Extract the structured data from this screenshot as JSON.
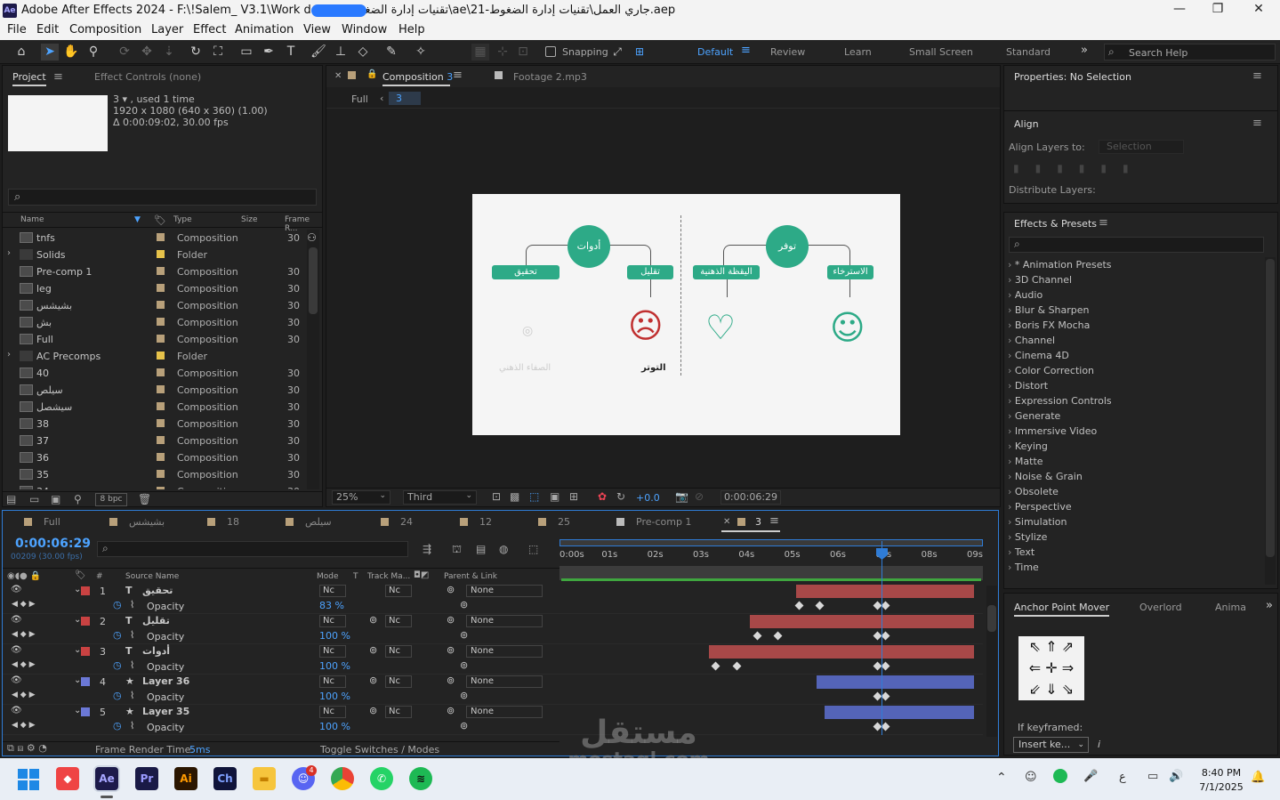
{
  "title": {
    "app_badge": "Ae",
    "text": "Adobe After Effects 2024 - F:\\!Salem_ V3.1\\Work d ... 21-تقنيات إدارة الضغوط\\ae\\جاري العمل\\تقنيات إدارة الضغوط-21.aep",
    "minimize": "—",
    "maximize": "❐",
    "close": "✕"
  },
  "menu": [
    "File",
    "Edit",
    "Composition",
    "Layer",
    "Effect",
    "Animation",
    "View",
    "Window",
    "Help"
  ],
  "toolbar": {
    "snapping": "Snapping",
    "workspaces": [
      "Default",
      "Review",
      "Learn",
      "Small Screen",
      "Standard"
    ],
    "more": "»",
    "search_help": "Search Help"
  },
  "project": {
    "tab_project": "Project",
    "tab_effects": "Effect Controls (none)",
    "info_line1": "3 ▾ , used 1 time",
    "info_line2": "1920 x 1080  (640 x 360) (1.00)",
    "info_line3": "Δ 0:00:09:02, 30.00 fps",
    "search_icon": "⌕",
    "columns": {
      "name": "Name",
      "type": "Type",
      "size": "Size",
      "frame": "Frame R..."
    },
    "items": [
      {
        "name": "tnfs",
        "type": "Composition",
        "fr": "30",
        "kind": "comp",
        "label": "#b8a07a"
      },
      {
        "name": "Solids",
        "type": "Folder",
        "fr": "",
        "kind": "folder",
        "label": "#e6c24a"
      },
      {
        "name": "Pre-comp 1",
        "type": "Composition",
        "fr": "30",
        "kind": "comp",
        "label": "#b8a07a"
      },
      {
        "name": "leg",
        "type": "Composition",
        "fr": "30",
        "kind": "comp",
        "label": "#b8a07a"
      },
      {
        "name": "بشيشس",
        "type": "Composition",
        "fr": "30",
        "kind": "comp",
        "label": "#b8a07a"
      },
      {
        "name": "بش",
        "type": "Composition",
        "fr": "30",
        "kind": "comp",
        "label": "#b8a07a"
      },
      {
        "name": "Full",
        "type": "Composition",
        "fr": "30",
        "kind": "comp",
        "label": "#b8a07a"
      },
      {
        "name": "AC Precomps",
        "type": "Folder",
        "fr": "",
        "kind": "folder",
        "label": "#e6c24a"
      },
      {
        "name": "40",
        "type": "Composition",
        "fr": "30",
        "kind": "comp",
        "label": "#b8a07a"
      },
      {
        "name": "سيلص",
        "type": "Composition",
        "fr": "30",
        "kind": "comp",
        "label": "#b8a07a"
      },
      {
        "name": "سيشصل",
        "type": "Composition",
        "fr": "30",
        "kind": "comp",
        "label": "#b8a07a"
      },
      {
        "name": "38",
        "type": "Composition",
        "fr": "30",
        "kind": "comp",
        "label": "#b8a07a"
      },
      {
        "name": "37",
        "type": "Composition",
        "fr": "30",
        "kind": "comp",
        "label": "#b8a07a"
      },
      {
        "name": "36",
        "type": "Composition",
        "fr": "30",
        "kind": "comp",
        "label": "#b8a07a"
      },
      {
        "name": "35",
        "type": "Composition",
        "fr": "30",
        "kind": "comp",
        "label": "#b8a07a"
      },
      {
        "name": "34",
        "type": "Composition",
        "fr": "30",
        "kind": "comp",
        "label": "#b8a07a"
      }
    ],
    "bpc": "8 bpc"
  },
  "viewer": {
    "tab_comp": "Composition",
    "tab_comp_num": "3",
    "tab_footage": "Footage  2.mp3",
    "crumb_full": "Full",
    "crumb_3": "3",
    "zoom": "25%",
    "view": "Third",
    "exposure": "+0.0",
    "timecode": "0:00:06:29"
  },
  "comp_content": {
    "circle_right": "توفر",
    "circle_left": "أدوات",
    "box1": "الاسترخاء",
    "box2": "اليقظة الذهنية",
    "box3": "تقليل",
    "box4": "تحقيق",
    "label_stress": "التوتر",
    "label_faded": "الصفاء الذهني"
  },
  "properties": {
    "header": "Properties: No Selection",
    "align": "Align",
    "align_to": "Align Layers to:",
    "align_select": "Selection",
    "distribute": "Distribute Layers:",
    "effects_title": "Effects & Presets",
    "effects": [
      "* Animation Presets",
      "3D Channel",
      "Audio",
      "Blur & Sharpen",
      "Boris FX Mocha",
      "Channel",
      "Cinema 4D",
      "Color Correction",
      "Distort",
      "Expression Controls",
      "Generate",
      "Immersive Video",
      "Keying",
      "Matte",
      "Noise & Grain",
      "Obsolete",
      "Perspective",
      "Simulation",
      "Stylize",
      "Text",
      "Time"
    ],
    "apm_tab": "Anchor Point Mover",
    "overlord_tab": "Overlord",
    "anima_tab": "Anima",
    "if_keyframed": "If keyframed:",
    "insert": "Insert ke...",
    "info_i": "i"
  },
  "timeline": {
    "tabs": [
      "Full",
      "بشيشس",
      "18",
      "سيلص",
      "24",
      "12",
      "25",
      "Pre-comp 1",
      "3"
    ],
    "timecode": "0:00:06:29",
    "frames": "00209 (30.00 fps)",
    "ruler": [
      "0:00s",
      "01s",
      "02s",
      "03s",
      "04s",
      "05s",
      "06s",
      "07s",
      "08s",
      "09s"
    ],
    "headers": {
      "num": "#",
      "source": "Source Name",
      "mode": "Mode",
      "t": "T",
      "track": "Track Ma...",
      "parent": "Parent & Link"
    },
    "layers": [
      {
        "num": "1",
        "icon": "T",
        "name": "تحقيق",
        "color": "#c94242",
        "opacity": "83 %",
        "start": 0.57,
        "kfs": [
          0.57,
          0.62,
          0.76,
          0.78
        ]
      },
      {
        "num": "2",
        "icon": "T",
        "name": "تقليل",
        "color": "#c94242",
        "opacity": "100 %",
        "start": 0.46,
        "kfs": [
          0.47,
          0.52,
          0.76,
          0.78
        ]
      },
      {
        "num": "3",
        "icon": "T",
        "name": "أدوات",
        "color": "#c94242",
        "opacity": "100 %",
        "start": 0.36,
        "kfs": [
          0.37,
          0.42,
          0.76,
          0.78
        ]
      },
      {
        "num": "4",
        "icon": "★",
        "name": "Layer 36",
        "color": "#6b78d6",
        "opacity": "100 %",
        "start": 0.62,
        "kfs": [
          0.76,
          0.78
        ]
      },
      {
        "num": "5",
        "icon": "★",
        "name": "Layer 35",
        "color": "#6b78d6",
        "opacity": "100 %",
        "start": 0.64,
        "kfs": [
          0.76,
          0.78
        ]
      }
    ],
    "prop_opacity": "Opacity",
    "mode_val": "Nc",
    "none": "None",
    "footer_render": "Frame Render Time:",
    "footer_ms": "5ms",
    "footer_toggle": "Toggle Switches / Modes"
  },
  "watermark": {
    "logo": "مستقل",
    "url": "mostaql.com"
  },
  "taskbar": {
    "apps": [
      "Ae",
      "Pr",
      "Ai",
      "Ch"
    ],
    "discord_badge": "4",
    "time": "8:40 PM",
    "date": "7/1/2025",
    "lang": "ع"
  }
}
